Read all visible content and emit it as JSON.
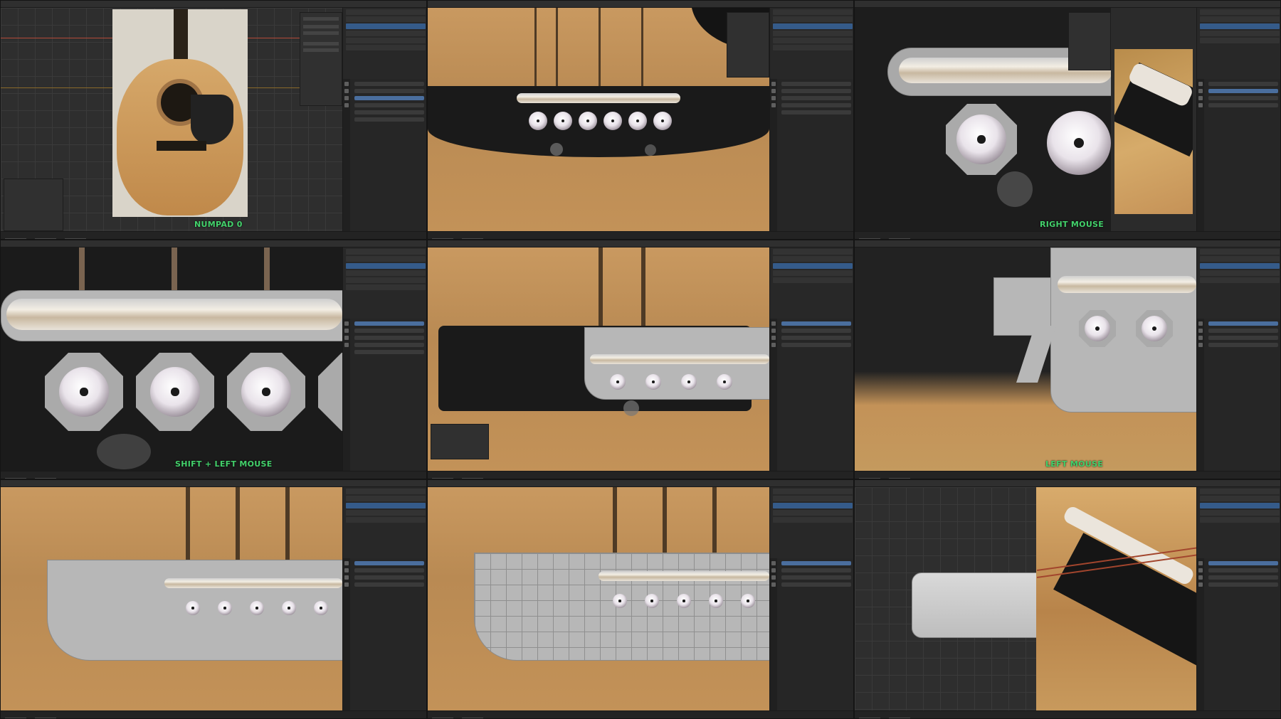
{
  "app": {
    "accent_select": "#355b8a",
    "hint_color": "#43d16b"
  },
  "cells": [
    {
      "id": "c1",
      "hint": "NUMPAD 0"
    },
    {
      "id": "c2",
      "hint": ""
    },
    {
      "id": "c3",
      "hint": "RIGHT MOUSE"
    },
    {
      "id": "c4",
      "hint": "SHIFT + LEFT MOUSE"
    },
    {
      "id": "c5",
      "hint": ""
    },
    {
      "id": "c6",
      "hint": "LEFT MOUSE"
    },
    {
      "id": "c7",
      "hint": ""
    },
    {
      "id": "c8",
      "hint": ""
    },
    {
      "id": "c9",
      "hint": ""
    }
  ],
  "icons": [
    "gear-icon",
    "camera-icon",
    "object-icon",
    "modifier-icon",
    "material-icon",
    "scene-icon"
  ]
}
